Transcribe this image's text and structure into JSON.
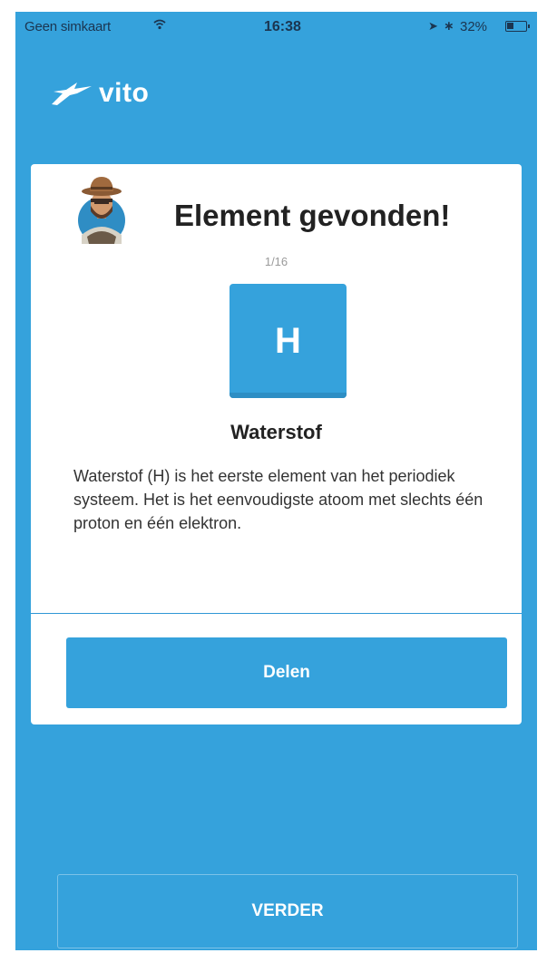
{
  "status_bar": {
    "carrier": "Geen simkaart",
    "time": "16:38",
    "battery_percent": "32%"
  },
  "app": {
    "logo_text": "vito"
  },
  "card": {
    "title": "Element gevonden!",
    "counter": "1/16",
    "element_symbol": "H",
    "element_name": "Waterstof",
    "description": "Waterstof (H) is het eerste element van het periodiek systeem. Het is het eenvoudigste atoom met slechts één proton en één elektron.",
    "share_label": "Delen"
  },
  "footer": {
    "next_label": "VERDER"
  },
  "colors": {
    "primary_blue": "#35a2dc",
    "card_bg": "#ffffff",
    "status_text": "#1b3550"
  }
}
